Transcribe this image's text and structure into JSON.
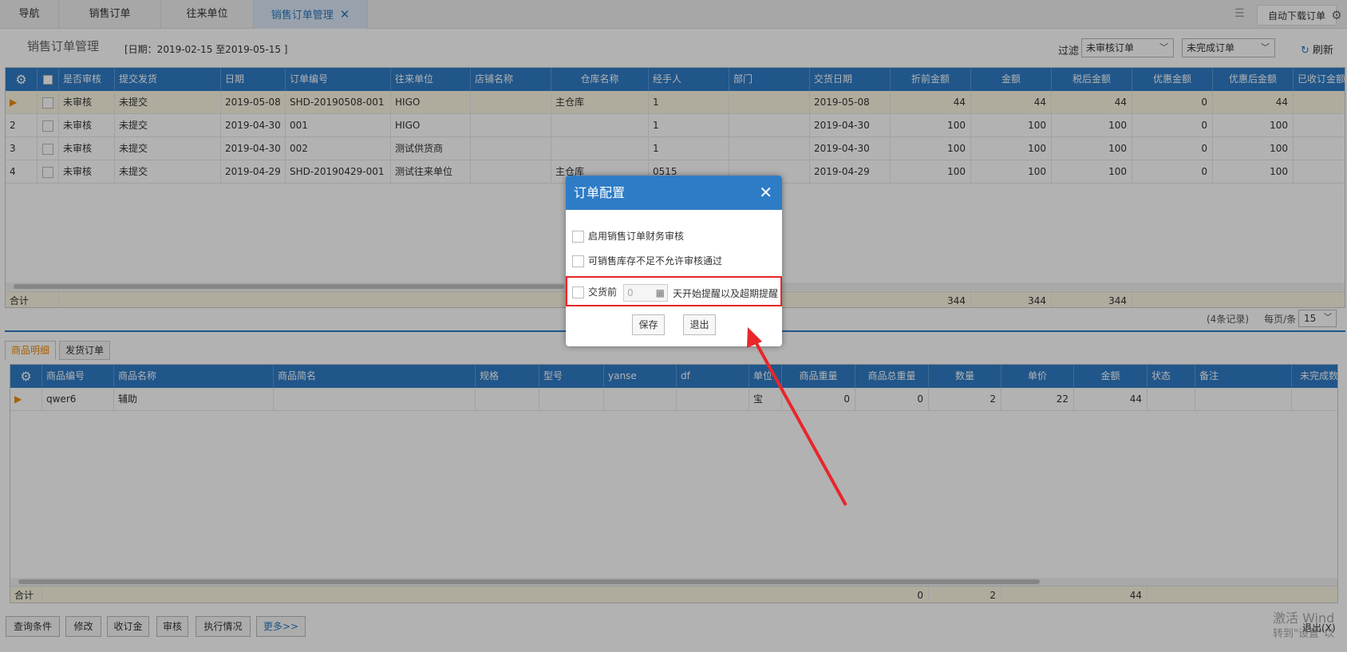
{
  "tabs": {
    "nav": "导航",
    "sales_order": "销售订单",
    "partners": "往来单位",
    "sales_order_mgmt": "销售订单管理",
    "close": "✕"
  },
  "toolbar": {
    "auto_download": "自动下载订单",
    "menu_icon": "list-icon",
    "settings_icon": "gear-icon"
  },
  "page": {
    "title": "销售订单管理",
    "date_range": "[日期：2019-02-15  至2019-05-15  ]",
    "filter_label": "过滤",
    "filter1": "未审核订单",
    "filter2": "未完成订单",
    "refresh": "刷新"
  },
  "order_grid": {
    "columns": [
      "是否审核",
      "提交发货",
      "日期",
      "订单编号",
      "往来单位",
      "店铺名称",
      "仓库名称",
      "经手人",
      "部门",
      "交货日期",
      "折前金额",
      "金额",
      "税后金额",
      "优惠金额",
      "优惠后金额",
      "已收订金额"
    ],
    "rows": [
      {
        "idx": "▶",
        "audit": "未审核",
        "ship": "未提交",
        "date": "2019-05-08",
        "no": "SHD-20190508-001",
        "partner": "HIGO",
        "shop": "",
        "wh": "主仓库",
        "handler": "1",
        "dept": "",
        "delivery": "2019-05-08",
        "pre": "44",
        "amount": "44",
        "after_tax": "44",
        "discount": "0",
        "after_disc": "44"
      },
      {
        "idx": "2",
        "audit": "未审核",
        "ship": "未提交",
        "date": "2019-04-30",
        "no": "001",
        "partner": "HIGO",
        "shop": "",
        "wh": "",
        "handler": "1",
        "dept": "",
        "delivery": "2019-04-30",
        "pre": "100",
        "amount": "100",
        "after_tax": "100",
        "discount": "0",
        "after_disc": "100"
      },
      {
        "idx": "3",
        "audit": "未审核",
        "ship": "未提交",
        "date": "2019-04-30",
        "no": "002",
        "partner": "测试供货商",
        "shop": "",
        "wh": "",
        "handler": "1",
        "dept": "",
        "delivery": "2019-04-30",
        "pre": "100",
        "amount": "100",
        "after_tax": "100",
        "discount": "0",
        "after_disc": "100"
      },
      {
        "idx": "4",
        "audit": "未审核",
        "ship": "未提交",
        "date": "2019-04-29",
        "no": "SHD-20190429-001",
        "partner": "测试往来单位",
        "shop": "",
        "wh": "主仓库",
        "handler": "0515",
        "dept": "",
        "delivery": "2019-04-29",
        "pre": "100",
        "amount": "100",
        "after_tax": "100",
        "discount": "0",
        "after_disc": "100"
      }
    ],
    "sum_label": "合计",
    "sum_pre": "344",
    "sum_amount": "344",
    "sum_after_tax": "344",
    "records": "(4条记录)",
    "per_page_label": "每页/条",
    "per_page": "15"
  },
  "detail_tabs": {
    "items": "商品明细",
    "shipments": "发货订单"
  },
  "detail_grid": {
    "columns": [
      "商品编号",
      "商品名称",
      "商品简名",
      "规格",
      "型号",
      "yanse",
      "df",
      "单位",
      "商品重量",
      "商品总重量",
      "数量",
      "单价",
      "金额",
      "状态",
      "备注",
      "未完成数"
    ],
    "rows": [
      {
        "idx": "▶",
        "code": "qwer6",
        "name": "辅助",
        "short": "",
        "spec": "",
        "model": "",
        "yanse": "",
        "df": "",
        "unit": "宝",
        "weight": "0",
        "total_weight": "0",
        "qty": "2",
        "price": "22",
        "amount": "44",
        "status": "",
        "note": ""
      }
    ],
    "sum_label": "合计",
    "sum_total_weight": "0",
    "sum_qty": "2",
    "sum_amount": "44"
  },
  "bottom_buttons": {
    "query": "查询条件",
    "edit": "修改",
    "deposit": "收订金",
    "audit": "审核",
    "exec": "执行情况",
    "more": "更多>>",
    "exit": "退出(X)"
  },
  "watermark": {
    "line1": "激活 Wind",
    "line2": "转到\"设置\"以"
  },
  "dialog": {
    "title": "订单配置",
    "close": "✕",
    "opt1": "启用销售订单财务审核",
    "opt2": "可销售库存不足不允许审核通过",
    "opt3_prefix": "交货前",
    "opt3_value": "0",
    "opt3_suffix": "天开始提醒以及超期提醒",
    "save": "保存",
    "exit": "退出"
  },
  "colors": {
    "accent": "#2e7cc6",
    "highlight": "#e8262b",
    "orange": "#f08a00"
  }
}
